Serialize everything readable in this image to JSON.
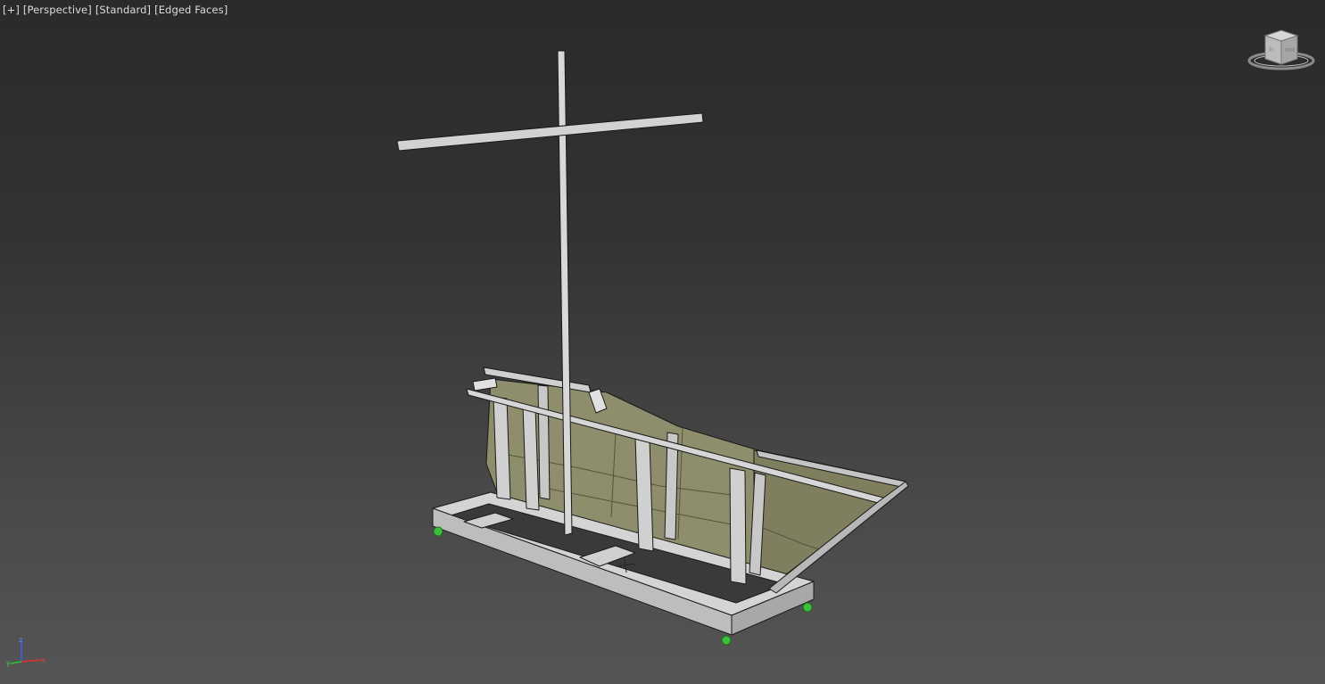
{
  "viewport": {
    "menu": "[+]",
    "view": "[Perspective]",
    "shading": "[Standard]",
    "display": "[Edged Faces]"
  },
  "viewcube": {
    "face_left": "fr",
    "face_right": "ont"
  },
  "axis": {
    "x": "x",
    "y": "y",
    "z": "z"
  },
  "colors": {
    "background_top": "#2a2a2a",
    "background_bottom": "#555555",
    "mesh_light": "#d9d9d9",
    "mesh_shade": "#a8a8a8",
    "hull_panel": "#8c8c6a",
    "edge": "#1a1a1a",
    "wheel": "#3cbf3c",
    "axis_x": "#e03030",
    "axis_y": "#30c030",
    "axis_z": "#4060ff"
  }
}
